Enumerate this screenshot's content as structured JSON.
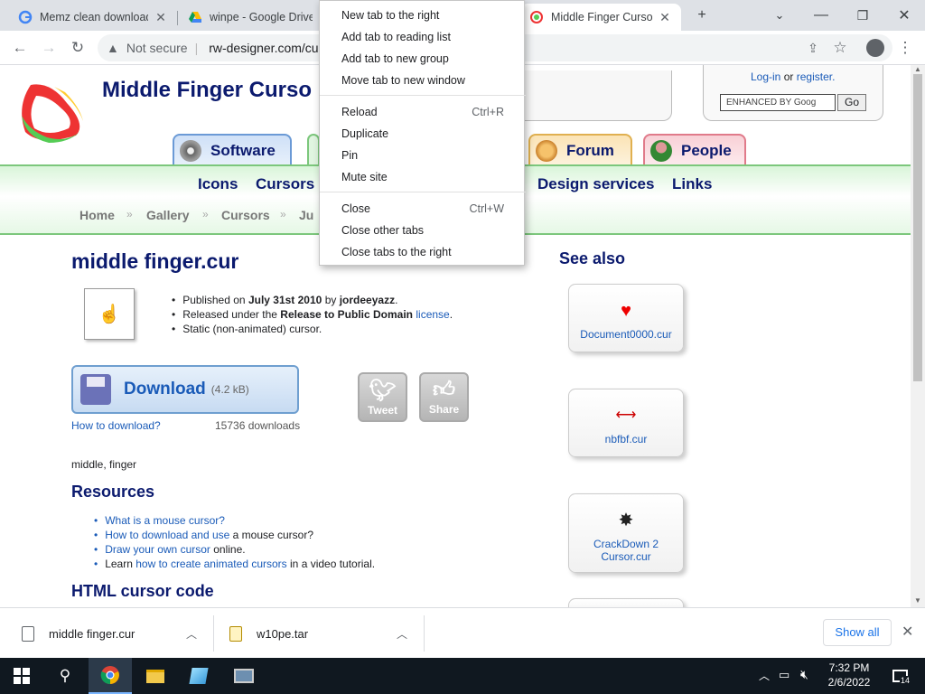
{
  "browser": {
    "tabs": [
      {
        "title": "Memz clean download",
        "icon": "google-icon"
      },
      {
        "title": "winpe - Google Drive",
        "icon": "google-drive-icon"
      },
      {
        "title": "Middle Finger Cursor",
        "icon": "rw-designer-icon"
      }
    ],
    "new_tab_symbol": "+",
    "security_label": "Not secure",
    "url": "rw-designer.com/cur"
  },
  "context_menu": {
    "items": [
      {
        "label": "New tab to the right",
        "shortcut": ""
      },
      {
        "label": "Add tab to reading list",
        "shortcut": ""
      },
      {
        "label": "Add tab to new group",
        "shortcut": ""
      },
      {
        "label": "Move tab to new window",
        "shortcut": ""
      },
      {
        "label": "Reload",
        "shortcut": "Ctrl+R"
      },
      {
        "label": "Duplicate",
        "shortcut": ""
      },
      {
        "label": "Pin",
        "shortcut": ""
      },
      {
        "label": "Mute site",
        "shortcut": ""
      },
      {
        "label": "Close",
        "shortcut": "Ctrl+W"
      },
      {
        "label": "Close other tabs",
        "shortcut": ""
      },
      {
        "label": "Close tabs to the right",
        "shortcut": ""
      }
    ]
  },
  "site": {
    "title": "Middle Finger Curso",
    "login_link": "Log-in",
    "login_or": "or",
    "register_link": "register.",
    "search_placeholder": "ENHANCED BY Goog",
    "search_button": "Go",
    "nav_tabs": [
      "Software",
      "Forum",
      "People"
    ],
    "menu": [
      "Icons",
      "Cursors",
      "Design services",
      "Links"
    ],
    "breadcrumb": [
      "Home",
      "Gallery",
      "Cursors",
      "Ju"
    ],
    "crumb_sep": "»"
  },
  "content": {
    "heading": "middle finger.cur",
    "info": {
      "published_prefix": "Published on",
      "date": "July 31st 2010",
      "by": "by",
      "author": "jordeeyazz",
      "released_prefix": "Released under the",
      "license_name": "Release to Public Domain",
      "license_link": "license",
      "static_text": "Static (non-animated) cursor."
    },
    "download_label": "Download",
    "download_size": "(4.2 kB)",
    "how_to_download": "How to download?",
    "download_count": "15736 downloads",
    "tweet_label": "Tweet",
    "share_label": "Share",
    "tags": "middle, finger",
    "resources_heading": "Resources",
    "resources": {
      "r1_link": "What is a mouse cursor?",
      "r2_link": "How to download and use",
      "r2_rest": "a mouse cursor?",
      "r3_link": "Draw your own cursor",
      "r3_rest": "online.",
      "r4_pre": "Learn",
      "r4_link": "how to create animated cursors",
      "r4_rest": "in a video tutorial."
    },
    "html_heading": "HTML cursor code",
    "see_also_heading": "See also",
    "see_also": [
      {
        "label": "Document0000.cur"
      },
      {
        "label": "nbfbf.cur"
      },
      {
        "label": "CrackDown 2 Cursor.cur"
      }
    ]
  },
  "downloads_shelf": {
    "items": [
      "middle finger.cur",
      "w10pe.tar"
    ],
    "show_all": "Show all"
  },
  "taskbar": {
    "time": "7:32 PM",
    "date": "2/6/2022",
    "notification_count": "14"
  },
  "colors": {
    "accent": "#1a5bb8",
    "site_title": "#0b1a6e",
    "green_bar": "#7cc77c"
  }
}
